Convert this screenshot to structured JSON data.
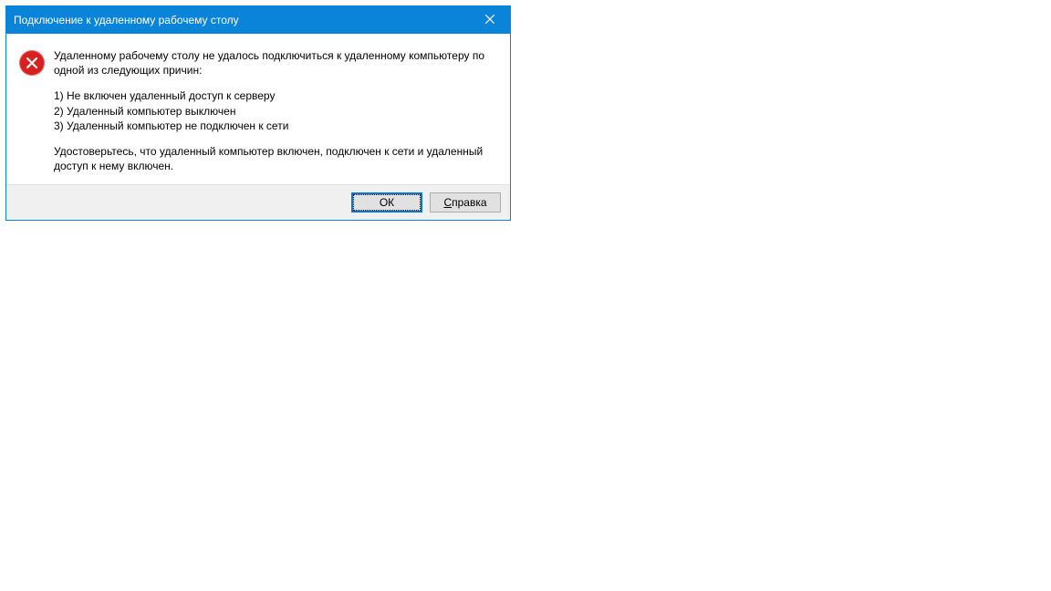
{
  "dialog": {
    "title": "Подключение к удаленному рабочему столу",
    "message_intro": "Удаленному рабочему столу не удалось подключиться к удаленному компьютеру по одной из следующих причин:",
    "reasons": {
      "r1": "1) Не включен удаленный доступ к серверу",
      "r2": "2) Удаленный компьютер выключен",
      "r3": "3) Удаленный компьютер не подключен к сети"
    },
    "message_outro": "Удостоверьтесь, что удаленный компьютер включен, подключен к сети и удаленный доступ к нему включен.",
    "buttons": {
      "ok": "ОК",
      "help_prefix": "С",
      "help_rest": "правка"
    }
  }
}
